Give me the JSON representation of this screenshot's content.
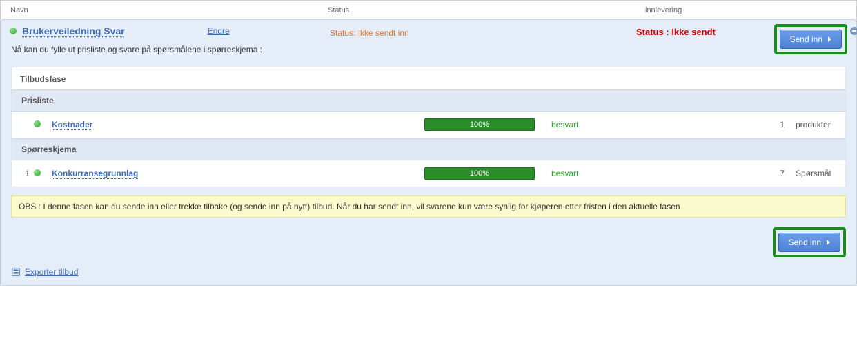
{
  "header": {
    "navn": "Navn",
    "status": "Status",
    "innlevering": "innlevering"
  },
  "response": {
    "title": "Brukerveiledning Svar",
    "edit_label": "Endre",
    "status_line": "Status: Ikke sendt inn",
    "status_badge": "Status : Ikke sendt",
    "send_label": "Send inn",
    "description": "Nå kan du fylle ut prisliste og svare på spørsmålene i spørreskjema :"
  },
  "phase": {
    "title": "Tilbudsfase",
    "sections": [
      {
        "heading": "Prisliste",
        "rows": [
          {
            "index": "",
            "name": "Kostnader",
            "progress": "100%",
            "status": "besvart",
            "count": "1",
            "unit": "produkter"
          }
        ]
      },
      {
        "heading": "Spørreskjema",
        "rows": [
          {
            "index": "1",
            "name": "Konkurransegrunnlag",
            "progress": "100%",
            "status": "besvart",
            "count": "7",
            "unit": "Spørsmål"
          }
        ]
      }
    ]
  },
  "obs": "OBS : I denne fasen kan du sende inn eller trekke tilbake (og sende inn på nytt) tilbud. Når du har sendt inn, vil svarene kun være synlig for kjøperen etter fristen i den aktuelle fasen",
  "export_label": "Exporter tilbud"
}
